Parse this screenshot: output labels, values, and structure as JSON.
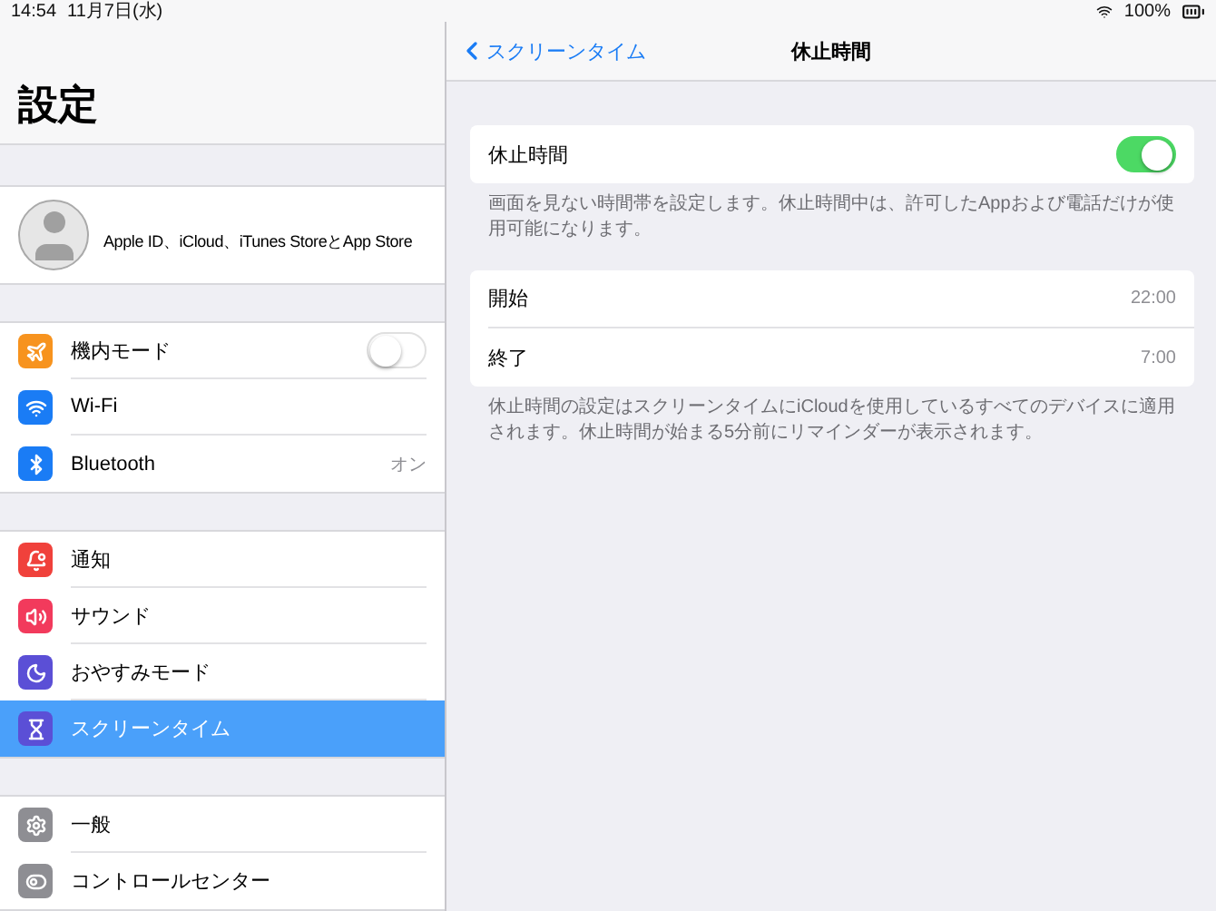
{
  "status_bar": {
    "time": "14:54",
    "date": "11月7日(水)",
    "battery": "100%"
  },
  "sidebar": {
    "title": "設定",
    "profile": {
      "label": "Apple ID、iCloud、iTunes StoreとApp Store"
    },
    "groups": [
      [
        {
          "label": "機内モード",
          "kind": "toggle",
          "on": false,
          "color": "#f7931e",
          "selected": false
        },
        {
          "label": "Wi-Fi",
          "kind": "plain",
          "color": "#1a7cf5",
          "selected": false
        },
        {
          "label": "Bluetooth",
          "kind": "value",
          "value": "オン",
          "color": "#1a7cf5",
          "selected": false
        }
      ],
      [
        {
          "label": "通知",
          "kind": "plain",
          "color": "#f0413b",
          "selected": false
        },
        {
          "label": "サウンド",
          "kind": "plain",
          "color": "#f23a5c",
          "selected": false
        },
        {
          "label": "おやすみモード",
          "kind": "plain",
          "color": "#5b4fd6",
          "selected": false
        },
        {
          "label": "スクリーンタイム",
          "kind": "plain",
          "color": "#5b4fd6",
          "selected": true
        }
      ],
      [
        {
          "label": "一般",
          "kind": "plain",
          "color": "#8e8e93",
          "selected": false
        },
        {
          "label": "コントロールセンター",
          "kind": "plain",
          "color": "#8e8e93",
          "selected": false
        }
      ]
    ]
  },
  "detail": {
    "back": "スクリーンタイム",
    "title": "休止時間",
    "toggle": {
      "label": "休止時間",
      "on": true
    },
    "note": "画面を見ない時間帯を設定します。休止時間中は、許可したAppおよび電話だけが使用可能になります。",
    "rows": [
      {
        "label": "開始",
        "value": "22:00"
      },
      {
        "label": "終了",
        "value": "7:00"
      }
    ],
    "note2": "休止時間の設定はスクリーンタイムにiCloudを使用しているすべてのデバイスに適用されます。休止時間が始まる5分前にリマインダーが表示されます。"
  }
}
